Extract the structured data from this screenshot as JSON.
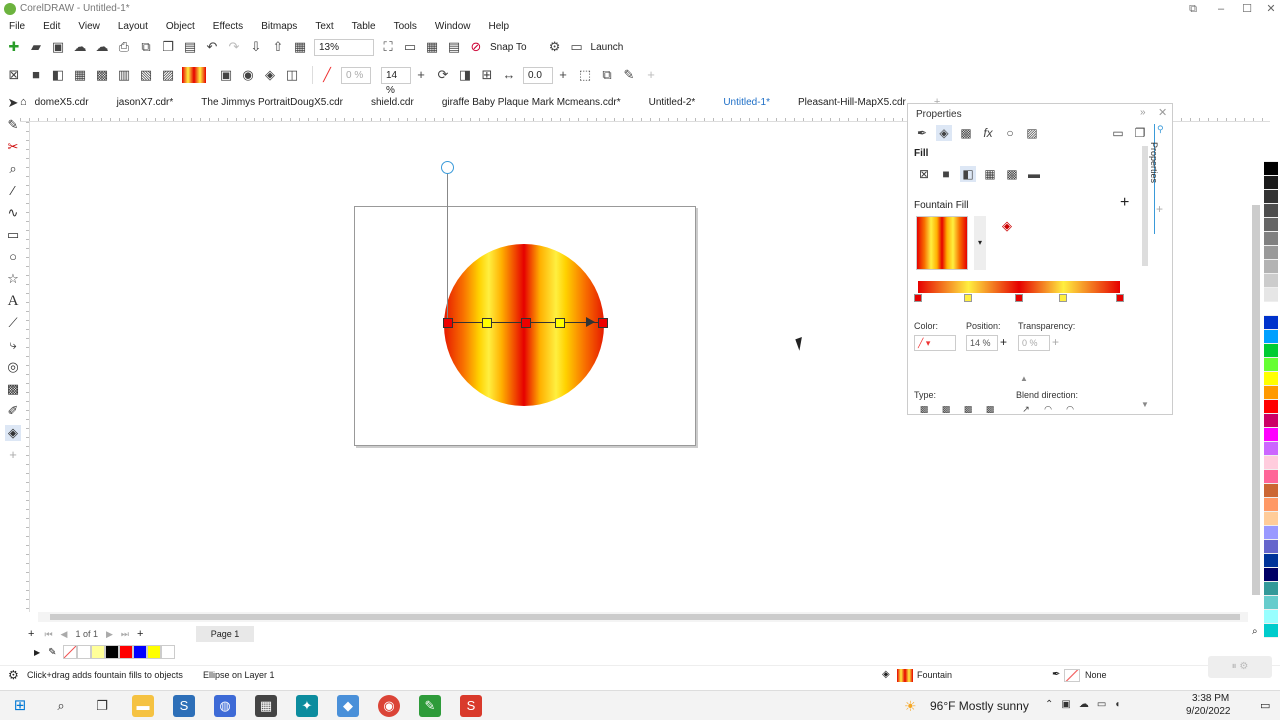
{
  "app": {
    "title": "CorelDRAW - Untitled-1*"
  },
  "menu": [
    "File",
    "Edit",
    "View",
    "Layout",
    "Object",
    "Effects",
    "Bitmaps",
    "Text",
    "Table",
    "Tools",
    "Window",
    "Help"
  ],
  "toolbar1": {
    "zoom": "13%",
    "snap_label": "Snap To",
    "launch_label": "Launch"
  },
  "toolbar2": {
    "transparency": "0 %",
    "position": "14 %",
    "angle": "0.0"
  },
  "doc_tabs": [
    {
      "label": "domeX5.cdr",
      "active": false
    },
    {
      "label": "jasonX7.cdr*",
      "active": false
    },
    {
      "label": "The Jimmys PortraitDougX5.cdr",
      "active": false
    },
    {
      "label": "shield.cdr",
      "active": false
    },
    {
      "label": "giraffe Baby Plaque Mark Mcmeans.cdr*",
      "active": false
    },
    {
      "label": "Untitled-2*",
      "active": false
    },
    {
      "label": "Untitled-1*",
      "active": true
    },
    {
      "label": "Pleasant-Hill-MapX5.cdr",
      "active": false
    }
  ],
  "properties": {
    "title": "Properties",
    "tab_label": "Properties",
    "fill_heading": "Fill",
    "fountain_heading": "Fountain Fill",
    "color_label": "Color:",
    "position_label": "Position:",
    "position_value": "14 %",
    "transparency_label": "Transparency:",
    "transparency_value": "0 %",
    "type_label": "Type:",
    "blend_label": "Blend direction:"
  },
  "page_nav": {
    "counter": "1 of 1",
    "page_tab": "Page 1"
  },
  "status": {
    "hint": "Click+drag adds fountain fills to objects",
    "object_info": "Ellipse on Layer 1",
    "fill_label": "Fountain",
    "outline_label": "None"
  },
  "taskbar": {
    "weather": "96°F  Mostly sunny",
    "time": "3:38 PM",
    "date": "9/20/2022"
  },
  "palette_colors": [
    "#ffffff",
    "#000000",
    "#1a1a1a",
    "#333333",
    "#4d4d4d",
    "#666666",
    "#808080",
    "#999999",
    "#b3b3b3",
    "#cccccc",
    "#e6e6e6",
    "#ffffff",
    "#0033cc",
    "#00a0ff",
    "#00cc33",
    "#66ff33",
    "#ffff00",
    "#ff9900",
    "#ff0000",
    "#cc0066",
    "#ff00ff",
    "#cc66ff",
    "#ffccdd",
    "#ff6699",
    "#cc6633",
    "#ff9966",
    "#ffcc99",
    "#9999ff",
    "#6666cc",
    "#003399",
    "#000066",
    "#339999",
    "#66cccc",
    "#99ffff",
    "#00cccc"
  ],
  "doc_palette": [
    "#ffffff",
    "#ffff99",
    "#000000",
    "#ff0000",
    "#0000ff",
    "#ffff00",
    "#ffffff"
  ]
}
